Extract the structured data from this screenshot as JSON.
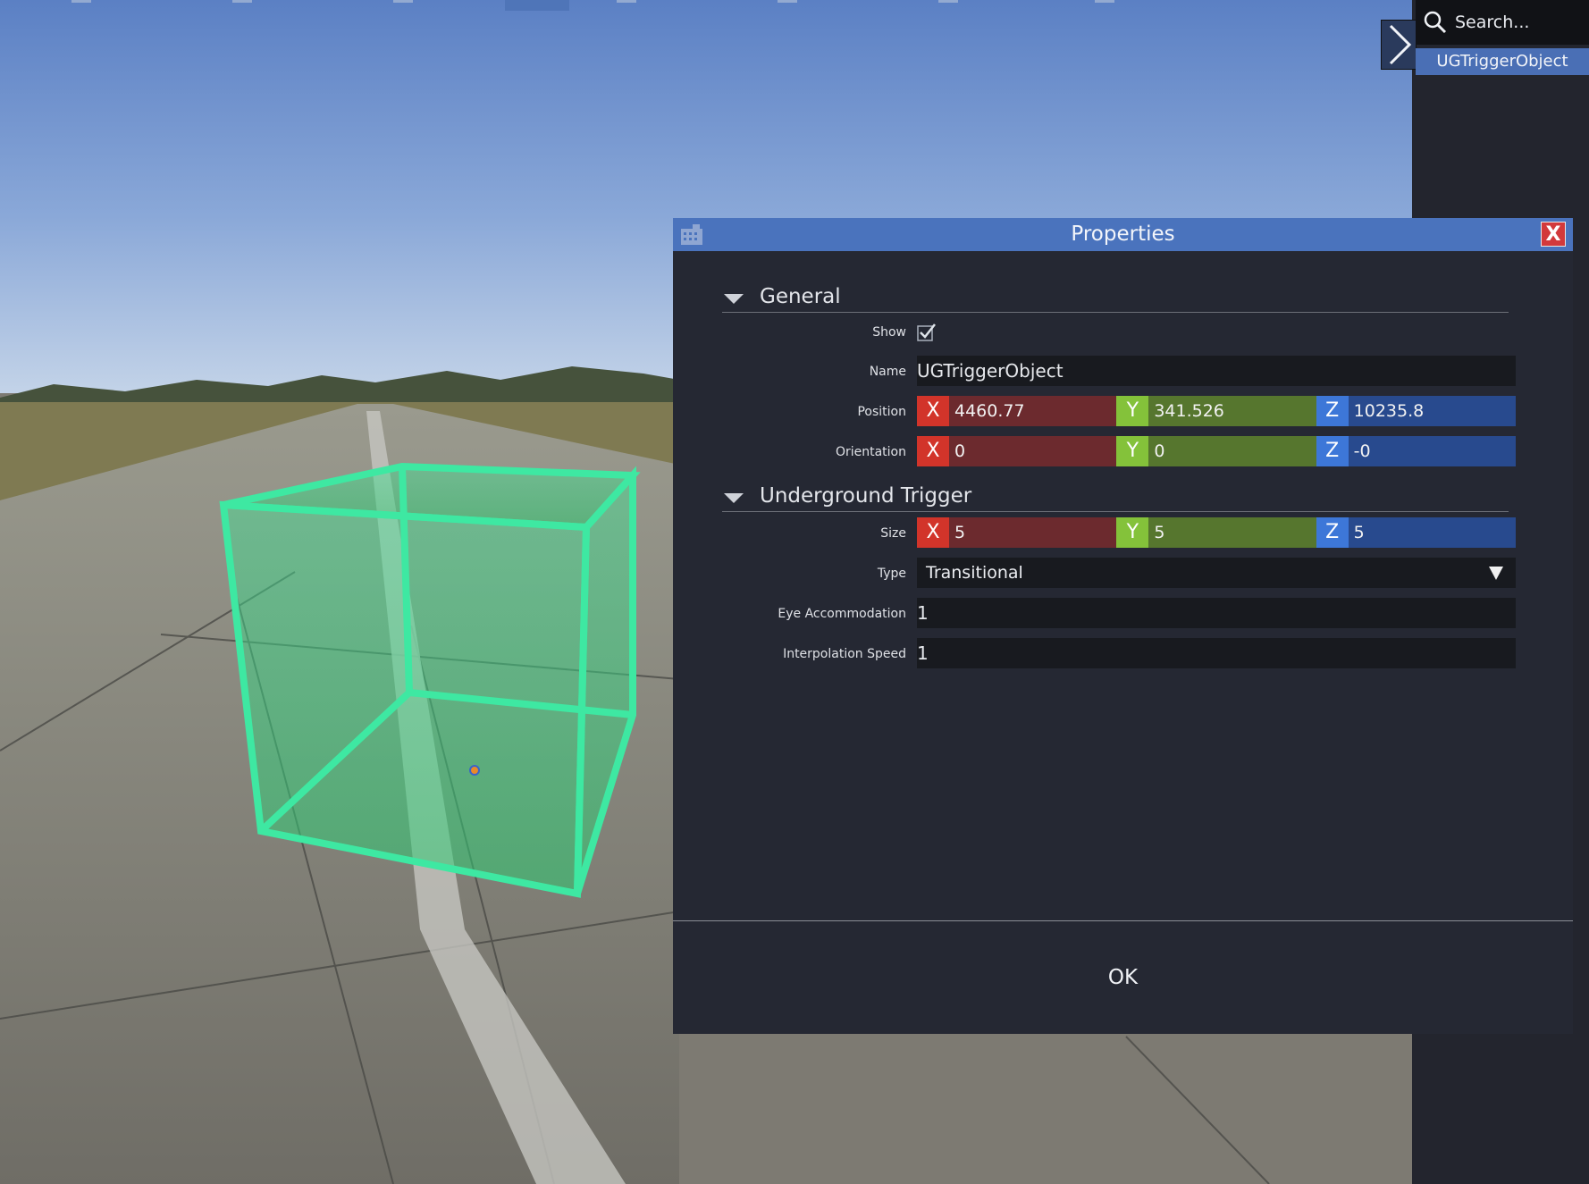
{
  "search": {
    "placeholder": "Search..."
  },
  "outliner": {
    "selected_item": "UGTriggerObject"
  },
  "dialog": {
    "title": "Properties",
    "close_label": "X",
    "ok_label": "OK",
    "sections": {
      "general": {
        "title": "General",
        "show_label": "Show",
        "show_checked": true,
        "name_label": "Name",
        "name_value": "UGTriggerObject",
        "position_label": "Position",
        "position": {
          "x": "4460.77",
          "y": "341.526",
          "z": "10235.8"
        },
        "orientation_label": "Orientation",
        "orientation": {
          "x": "0",
          "y": "0",
          "z": "-0"
        }
      },
      "underground_trigger": {
        "title": "Underground Trigger",
        "size_label": "Size",
        "size": {
          "x": "5",
          "y": "5",
          "z": "5"
        },
        "type_label": "Type",
        "type_value": "Transitional",
        "eye_accommodation_label": "Eye Accommodation",
        "eye_accommodation_value": "1",
        "interpolation_speed_label": "Interpolation Speed",
        "interpolation_speed_value": "1"
      }
    }
  },
  "axis_labels": {
    "x": "X",
    "y": "Y",
    "z": "Z"
  },
  "colors": {
    "axis_x": "#d2342a",
    "axis_y": "#84c23a",
    "axis_z": "#3d77d8",
    "titlebar": "#4a73bd",
    "trigger_volume": "#3ee8a2"
  }
}
